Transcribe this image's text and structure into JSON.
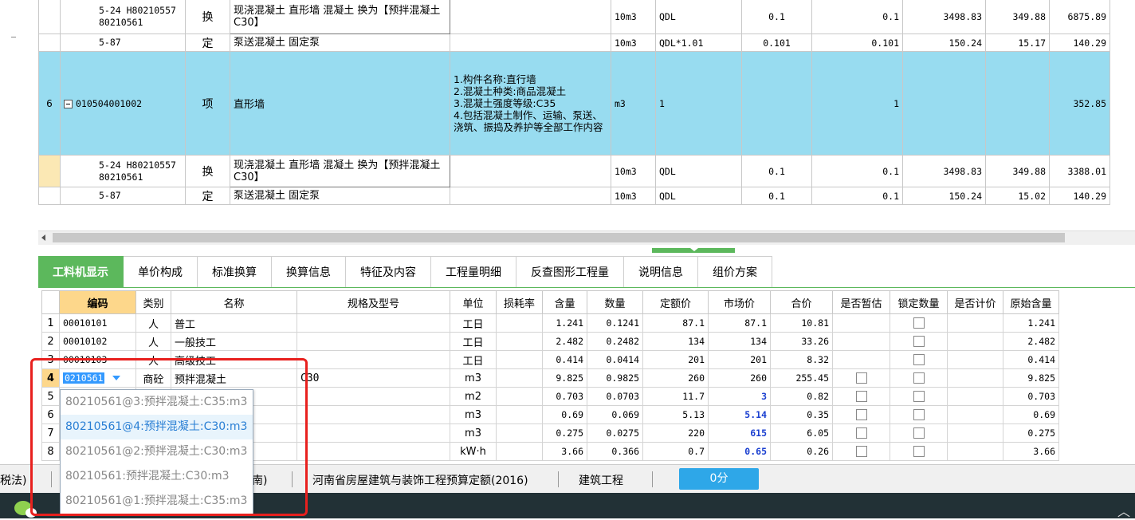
{
  "top_grid": {
    "rows": [
      {
        "no": "",
        "code": "5-24 H80210557 80210561",
        "type": "换",
        "name": "现浇混凝土 直形墙 混凝土  换为【预拌混凝土 C30】",
        "feature": "",
        "unit": "10m3",
        "qty_expr": "QDL",
        "qty": "0.1",
        "qty2": "0.1",
        "price": "3498.83",
        "comp": "349.88",
        "total": "6875.89",
        "kind": "sub"
      },
      {
        "no": "",
        "code": "5-87",
        "type": "定",
        "name": "泵送混凝土 固定泵",
        "feature": "",
        "unit": "10m3",
        "qty_expr": "QDL*1.01",
        "qty": "0.101",
        "qty2": "0.101",
        "price": "150.24",
        "comp": "15.17",
        "total": "140.29",
        "kind": "sub"
      },
      {
        "no": "6",
        "code": "010504001002",
        "type": "项",
        "name": "直形墙",
        "feature": "1.构件名称:直行墙\n2.混凝土种类:商品混凝土\n3.混凝土强度等级:C35\n4.包括混凝土制作、运输、泵送、浇筑、振捣及养护等全部工作内容",
        "unit": "m3",
        "qty_expr": "1",
        "qty": "",
        "qty2": "1",
        "price": "",
        "comp": "",
        "total": "352.85",
        "kind": "item"
      },
      {
        "no": "",
        "code": "5-24 H80210557 80210561",
        "type": "换",
        "name": "现浇混凝土 直形墙 混凝土  换为【预拌混凝土 C30】",
        "feature": "",
        "unit": "10m3",
        "qty_expr": "QDL",
        "qty": "0.1",
        "qty2": "0.1",
        "price": "3498.83",
        "comp": "349.88",
        "total": "3388.01",
        "kind": "sub"
      },
      {
        "no": "",
        "code": "5-87",
        "type": "定",
        "name": "泵送混凝土 固定泵",
        "feature": "",
        "unit": "10m3",
        "qty_expr": "QDL",
        "qty": "0.1",
        "qty2": "0.1",
        "price": "150.24",
        "comp": "15.02",
        "total": "140.29",
        "kind": "sub"
      }
    ]
  },
  "tabs": [
    "工料机显示",
    "单价构成",
    "标准换算",
    "换算信息",
    "特征及内容",
    "工程量明细",
    "反查图形工程量",
    "说明信息",
    "组价方案"
  ],
  "bottom_grid": {
    "headers": [
      "编码",
      "类别",
      "名称",
      "规格及型号",
      "单位",
      "损耗率",
      "含量",
      "数量",
      "定额价",
      "市场价",
      "合价",
      "是否暂估",
      "锁定数量",
      "是否计价",
      "原始含量"
    ],
    "rows": [
      {
        "n": "1",
        "code": "00010101",
        "cat": "人",
        "name": "普工",
        "spec": "",
        "unit": "工日",
        "loss": "",
        "content": "1.241",
        "qty": "0.1241",
        "dprice": "87.1",
        "mprice": "87.1",
        "sum": "10.81",
        "est": false,
        "lock": true,
        "orig": "1.241",
        "blue": false
      },
      {
        "n": "2",
        "code": "00010102",
        "cat": "人",
        "name": "一般技工",
        "spec": "",
        "unit": "工日",
        "loss": "",
        "content": "2.482",
        "qty": "0.2482",
        "dprice": "134",
        "mprice": "134",
        "sum": "33.26",
        "est": false,
        "lock": true,
        "orig": "2.482",
        "blue": false
      },
      {
        "n": "3",
        "code": "00010103",
        "cat": "人",
        "name": "高级技工",
        "spec": "",
        "unit": "工日",
        "loss": "",
        "content": "0.414",
        "qty": "0.0414",
        "dprice": "201",
        "mprice": "201",
        "sum": "8.32",
        "est": false,
        "lock": true,
        "orig": "0.414",
        "blue": false
      },
      {
        "n": "4",
        "code": "0210561",
        "cat": "商砼",
        "name": "预拌混凝土",
        "spec": "C30",
        "unit": "m3",
        "loss": "",
        "content": "9.825",
        "qty": "0.9825",
        "dprice": "260",
        "mprice": "260",
        "sum": "255.45",
        "est": true,
        "lock": true,
        "orig": "9.825",
        "blue": false
      },
      {
        "n": "5",
        "code": "",
        "cat": "",
        "name": "",
        "spec": "",
        "unit": "m2",
        "loss": "",
        "content": "0.703",
        "qty": "0.0703",
        "dprice": "11.7",
        "mprice": "3",
        "sum": "0.82",
        "est": true,
        "lock": true,
        "orig": "0.703",
        "blue": true
      },
      {
        "n": "6",
        "code": "",
        "cat": "",
        "name": "",
        "spec": "",
        "unit": "m3",
        "loss": "",
        "content": "0.69",
        "qty": "0.069",
        "dprice": "5.13",
        "mprice": "5.14",
        "sum": "0.35",
        "est": true,
        "lock": true,
        "orig": "0.69",
        "blue": true
      },
      {
        "n": "7",
        "code": "",
        "cat": "",
        "name": "",
        "spec": "",
        "unit": "m3",
        "loss": "",
        "content": "0.275",
        "qty": "0.0275",
        "dprice": "220",
        "mprice": "615",
        "sum": "6.05",
        "est": true,
        "lock": true,
        "orig": "0.275",
        "blue": true
      },
      {
        "n": "8",
        "code": "",
        "cat": "",
        "name": "",
        "spec": "",
        "unit": "kW·h",
        "loss": "",
        "content": "3.66",
        "qty": "0.366",
        "dprice": "0.7",
        "mprice": "0.65",
        "sum": "0.26",
        "est": true,
        "lock": true,
        "orig": "3.66",
        "blue": true
      }
    ]
  },
  "dropdown": {
    "options": [
      "80210561@3:预拌混凝土:C35:m3",
      "80210561@4:预拌混凝土:C30:m3",
      "80210561@2:预拌混凝土:C30:m3",
      "80210561:预拌混凝土:C30:m3",
      "80210561@1:预拌混凝土:C35:m3"
    ],
    "highlighted": 1
  },
  "status_bar": {
    "left": "税法)",
    "mid": "南)",
    "quota": "河南省房屋建筑与装饰工程预算定额(2016)",
    "project_type": "建筑工程",
    "score": "0分"
  },
  "colors": {
    "accent_green": "#5cb85c",
    "selected_row": "#98dcf0",
    "header_highlight": "#fdd78b",
    "status_pill": "#2ea7e8",
    "red_box": "#e8201e"
  }
}
